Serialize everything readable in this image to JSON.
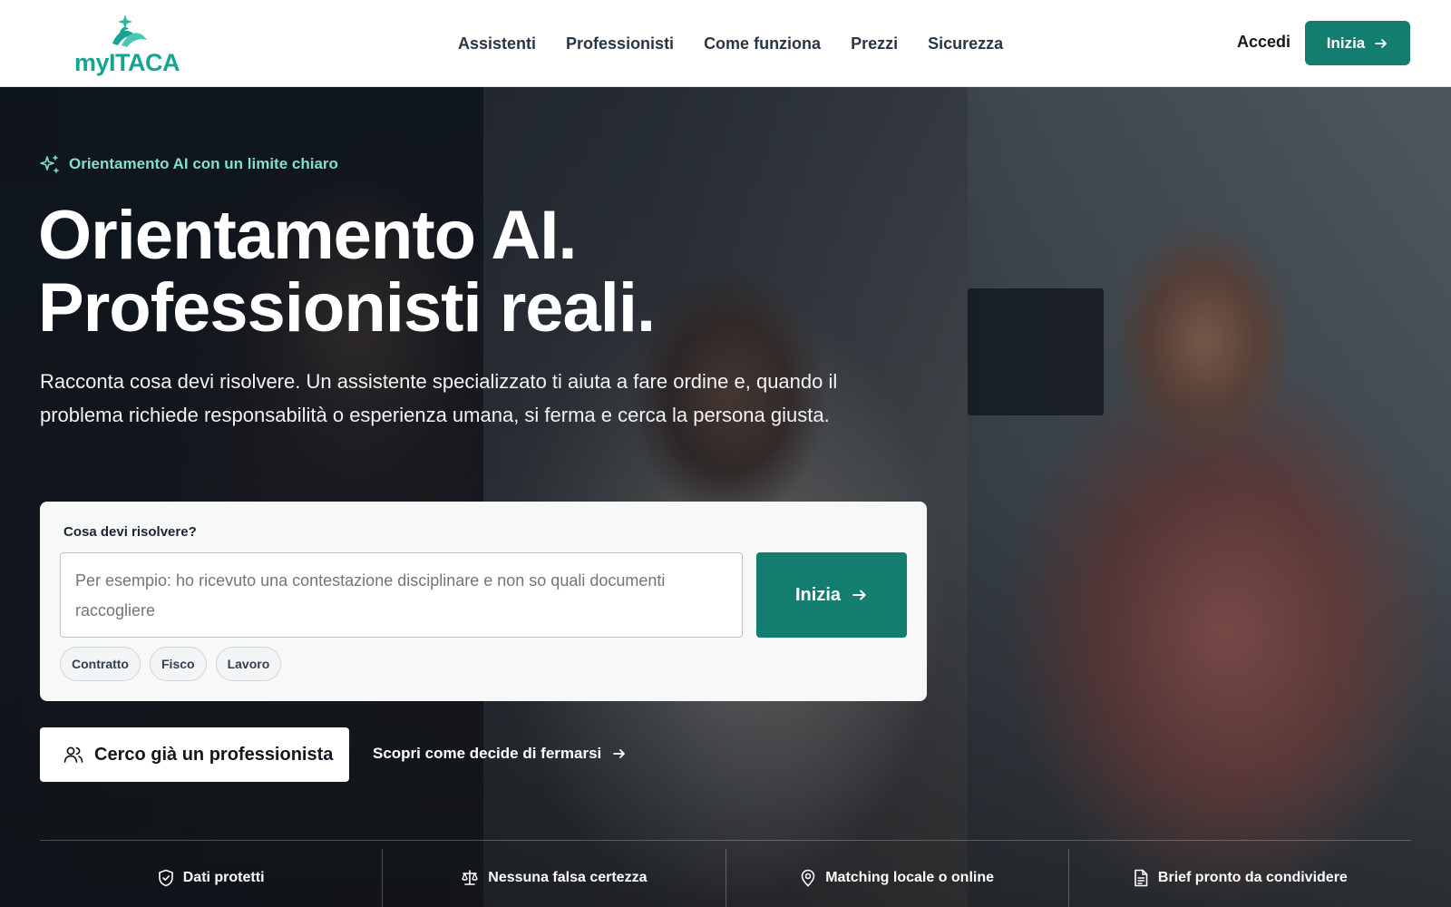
{
  "brand": {
    "name": "myITACA",
    "accent": "#17a592",
    "button_color": "#137d6f"
  },
  "nav": {
    "items": [
      {
        "label": "Assistenti"
      },
      {
        "label": "Professionisti"
      },
      {
        "label": "Come funziona"
      },
      {
        "label": "Prezzi"
      },
      {
        "label": "Sicurezza"
      }
    ],
    "login_label": "Accedi",
    "cta_label": "Inizia",
    "cta_icon": "arrow-right-icon"
  },
  "hero": {
    "eyebrow": "Orientamento AI con un limite chiaro",
    "eyebrow_icon": "sparkles-icon",
    "headline_line1": "Orientamento AI.",
    "headline_line2": "Professionisti reali.",
    "lead": "Racconta cosa devi risolvere. Un assistente specializzato ti aiuta a fare ordine e, quando il problema richiede responsabilità o esperienza umana, si ferma e cerca la persona giusta."
  },
  "search_card": {
    "label": "Cosa devi risolvere?",
    "placeholder": "Per esempio: ho ricevuto una contestazione disciplinare e non so quali documenti raccogliere",
    "value": "",
    "submit_label": "Inizia",
    "chips": [
      {
        "label": "Contratto"
      },
      {
        "label": "Fisco"
      },
      {
        "label": "Lavoro"
      }
    ]
  },
  "actions": {
    "professional_label": "Cerco già un professionista",
    "professional_icon": "users-icon",
    "discover_label": "Scopri come decide di fermarsi"
  },
  "trust_bar": {
    "items": [
      {
        "label": "Dati protetti",
        "icon": "shield-check-icon"
      },
      {
        "label": "Nessuna falsa certezza",
        "icon": "scale-icon"
      },
      {
        "label": "Matching locale o online",
        "icon": "map-pin-icon"
      },
      {
        "label": "Brief pronto da condividere",
        "icon": "document-icon"
      }
    ]
  }
}
